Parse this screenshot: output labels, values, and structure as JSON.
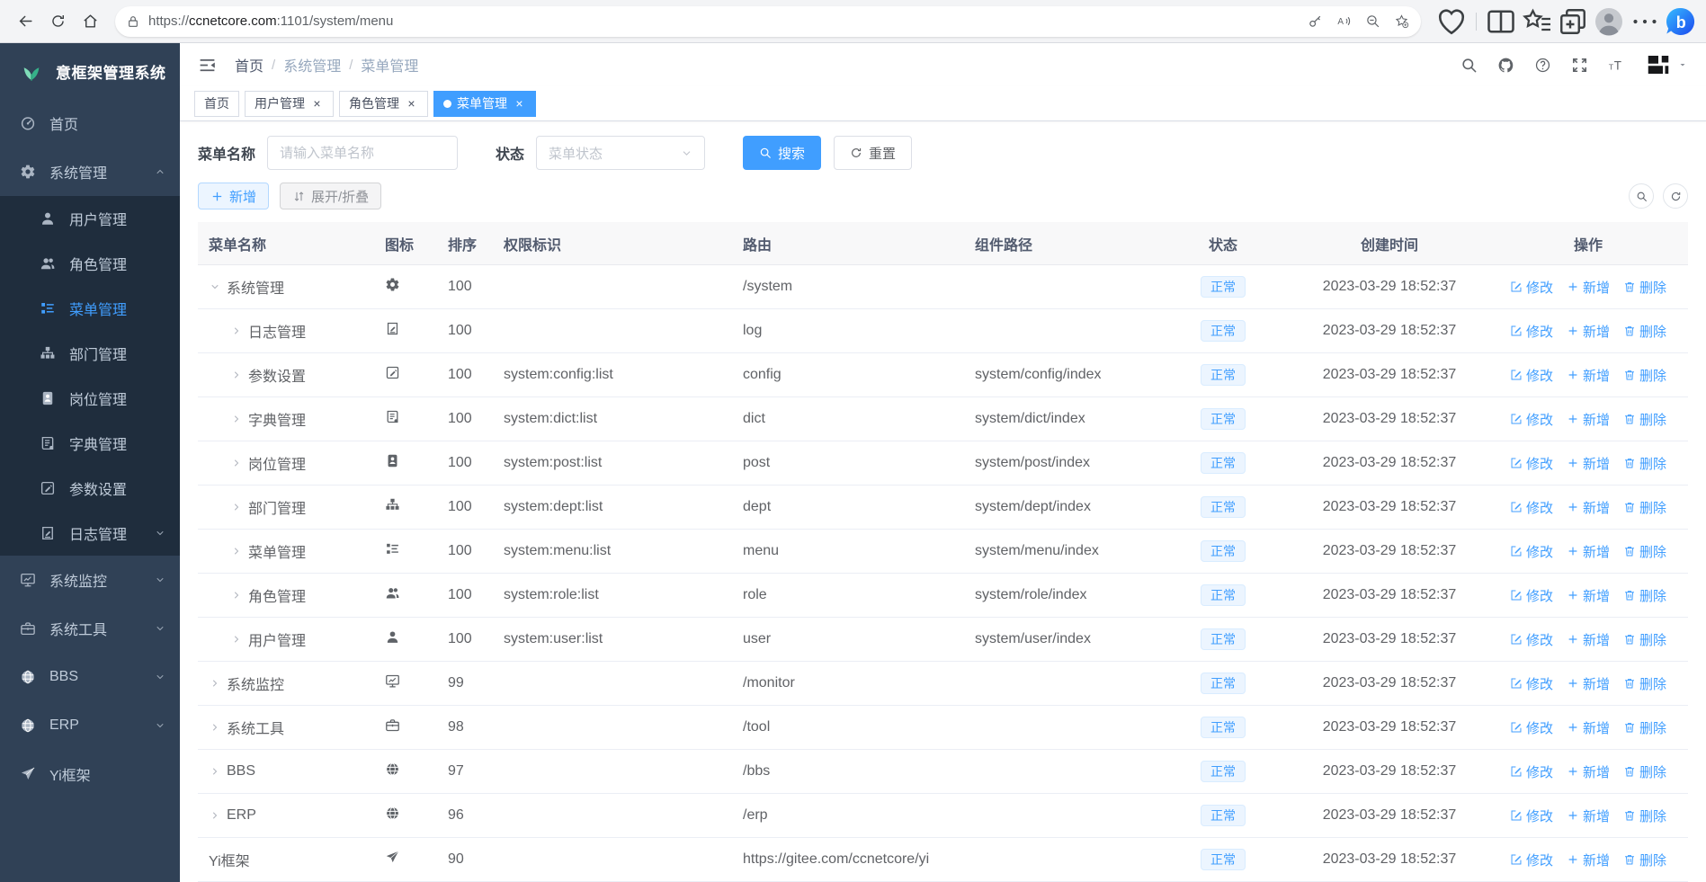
{
  "browser": {
    "url_scheme": "https://",
    "url_domain": "ccnetcore.com",
    "url_rest": ":1101/system/menu",
    "left_icons": [
      "back-icon",
      "reload-icon",
      "home-icon"
    ],
    "addr_icons": [
      "key-icon",
      "read-aloud-icon",
      "zoom-out-icon",
      "star-plus-icon"
    ],
    "right_icons": [
      "essentials-icon",
      "divider",
      "split-screen-icon",
      "favorites-bar-icon",
      "collections-icon",
      "profile-avatar-icon",
      "more-icon",
      "bing-icon"
    ]
  },
  "app": {
    "title": "意框架管理系统",
    "logo_icon": "leaf-logo-icon"
  },
  "sidebar": {
    "items": [
      {
        "label": "首页",
        "icon": "gauge-icon",
        "type": "top"
      },
      {
        "label": "系统管理",
        "icon": "gear-icon",
        "type": "top",
        "chevron": "up"
      },
      {
        "label": "用户管理",
        "icon": "user-icon",
        "type": "sub"
      },
      {
        "label": "角色管理",
        "icon": "users-icon",
        "type": "sub"
      },
      {
        "label": "菜单管理",
        "icon": "menu-list-icon",
        "type": "sub",
        "active": true
      },
      {
        "label": "部门管理",
        "icon": "org-tree-icon",
        "type": "sub"
      },
      {
        "label": "岗位管理",
        "icon": "badge-icon",
        "type": "sub"
      },
      {
        "label": "字典管理",
        "icon": "book-icon",
        "type": "sub"
      },
      {
        "label": "参数设置",
        "icon": "edit-square-icon",
        "type": "sub"
      },
      {
        "label": "日志管理",
        "icon": "log-icon",
        "type": "sub",
        "chevron": "down"
      },
      {
        "label": "系统监控",
        "icon": "monitor-icon",
        "type": "top",
        "chevron": "down"
      },
      {
        "label": "系统工具",
        "icon": "toolbox-icon",
        "type": "top",
        "chevron": "down"
      },
      {
        "label": "BBS",
        "icon": "globe-icon",
        "type": "top",
        "chevron": "down"
      },
      {
        "label": "ERP",
        "icon": "globe-icon",
        "type": "top",
        "chevron": "down"
      },
      {
        "label": "Yi框架",
        "icon": "plane-icon",
        "type": "top"
      }
    ]
  },
  "navbar": {
    "breadcrumb": [
      "首页",
      "系统管理",
      "菜单管理"
    ],
    "icons": [
      "search-icon",
      "github-icon",
      "help-icon",
      "fullscreen-icon",
      "font-size-icon"
    ],
    "avatar_icon": "yi-logo-icon"
  },
  "tabs": [
    {
      "label": "首页"
    },
    {
      "label": "用户管理",
      "closable": true
    },
    {
      "label": "角色管理",
      "closable": true
    },
    {
      "label": "菜单管理",
      "closable": true,
      "active": true
    }
  ],
  "filters": {
    "name_label": "菜单名称",
    "name_placeholder": "请输入菜单名称",
    "status_label": "状态",
    "status_placeholder": "菜单状态",
    "search_label": "搜索",
    "reset_label": "重置"
  },
  "toolbar": {
    "add_label": "新增",
    "expand_label": "展开/折叠"
  },
  "table": {
    "headers": [
      "菜单名称",
      "图标",
      "排序",
      "权限标识",
      "路由",
      "组件路径",
      "状态",
      "创建时间",
      "操作"
    ],
    "action_labels": {
      "edit": "修改",
      "add": "新增",
      "del": "删除"
    },
    "rows": [
      {
        "name": "系统管理",
        "icon": "gear-icon",
        "level": 0,
        "expand": "open",
        "sort": "100",
        "perm": "",
        "route": "/system",
        "component": "",
        "status": "正常",
        "created": "2023-03-29 18:52:37"
      },
      {
        "name": "日志管理",
        "icon": "log-icon",
        "level": 1,
        "expand": "closed",
        "sort": "100",
        "perm": "",
        "route": "log",
        "component": "",
        "status": "正常",
        "created": "2023-03-29 18:52:37"
      },
      {
        "name": "参数设置",
        "icon": "edit-square-icon",
        "level": 1,
        "expand": "closed",
        "sort": "100",
        "perm": "system:config:list",
        "route": "config",
        "component": "system/config/index",
        "status": "正常",
        "created": "2023-03-29 18:52:37"
      },
      {
        "name": "字典管理",
        "icon": "book-icon",
        "level": 1,
        "expand": "closed",
        "sort": "100",
        "perm": "system:dict:list",
        "route": "dict",
        "component": "system/dict/index",
        "status": "正常",
        "created": "2023-03-29 18:52:37"
      },
      {
        "name": "岗位管理",
        "icon": "badge-icon",
        "level": 1,
        "expand": "closed",
        "sort": "100",
        "perm": "system:post:list",
        "route": "post",
        "component": "system/post/index",
        "status": "正常",
        "created": "2023-03-29 18:52:37"
      },
      {
        "name": "部门管理",
        "icon": "org-tree-icon",
        "level": 1,
        "expand": "closed",
        "sort": "100",
        "perm": "system:dept:list",
        "route": "dept",
        "component": "system/dept/index",
        "status": "正常",
        "created": "2023-03-29 18:52:37"
      },
      {
        "name": "菜单管理",
        "icon": "menu-list-icon",
        "level": 1,
        "expand": "closed",
        "sort": "100",
        "perm": "system:menu:list",
        "route": "menu",
        "component": "system/menu/index",
        "status": "正常",
        "created": "2023-03-29 18:52:37"
      },
      {
        "name": "角色管理",
        "icon": "users-icon",
        "level": 1,
        "expand": "closed",
        "sort": "100",
        "perm": "system:role:list",
        "route": "role",
        "component": "system/role/index",
        "status": "正常",
        "created": "2023-03-29 18:52:37"
      },
      {
        "name": "用户管理",
        "icon": "user-icon",
        "level": 1,
        "expand": "closed",
        "sort": "100",
        "perm": "system:user:list",
        "route": "user",
        "component": "system/user/index",
        "status": "正常",
        "created": "2023-03-29 18:52:37"
      },
      {
        "name": "系统监控",
        "icon": "monitor-icon",
        "level": 0,
        "expand": "closed",
        "sort": "99",
        "perm": "",
        "route": "/monitor",
        "component": "",
        "status": "正常",
        "created": "2023-03-29 18:52:37"
      },
      {
        "name": "系统工具",
        "icon": "toolbox-icon",
        "level": 0,
        "expand": "closed",
        "sort": "98",
        "perm": "",
        "route": "/tool",
        "component": "",
        "status": "正常",
        "created": "2023-03-29 18:52:37"
      },
      {
        "name": "BBS",
        "icon": "globe-icon",
        "level": 0,
        "expand": "closed",
        "sort": "97",
        "perm": "",
        "route": "/bbs",
        "component": "",
        "status": "正常",
        "created": "2023-03-29 18:52:37"
      },
      {
        "name": "ERP",
        "icon": "globe-icon",
        "level": 0,
        "expand": "closed",
        "sort": "96",
        "perm": "",
        "route": "/erp",
        "component": "",
        "status": "正常",
        "created": "2023-03-29 18:52:37"
      },
      {
        "name": "Yi框架",
        "icon": "plane-icon",
        "level": 0,
        "expand": "none",
        "sort": "90",
        "perm": "",
        "route": "https://gitee.com/ccnetcore/yi",
        "component": "",
        "status": "正常",
        "created": "2023-03-29 18:52:37"
      }
    ]
  },
  "colors": {
    "accent": "#409eff",
    "sidebar_bg": "#304156",
    "submenu_bg": "#1f2d3d",
    "status_badge_bg": "#ecf5ff",
    "status_badge_text": "#409eff"
  }
}
